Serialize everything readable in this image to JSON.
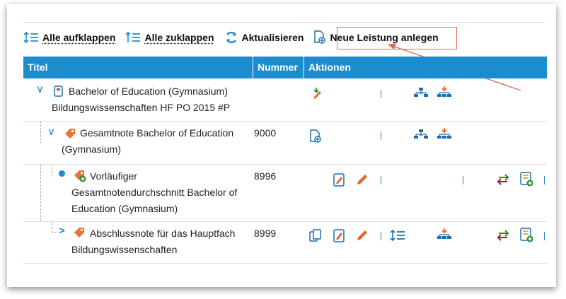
{
  "toolbar": {
    "expand_all": "Alle aufklappen",
    "collapse_all": "Alle zuklappen",
    "refresh": "Aktualisieren",
    "new_achievement": "Neue Leistung anlegen"
  },
  "table": {
    "columns": [
      "Titel",
      "Nummer",
      "Aktionen"
    ],
    "rows": [
      {
        "title_line1": "Bachelor of Education (Gymnasium)",
        "title_line2": "Bildungswissenschaften HF PO 2015 #P",
        "number": ""
      },
      {
        "title_line1": "Gesamtnote Bachelor of Education",
        "title_line2": "(Gymnasium)",
        "number": "9000"
      },
      {
        "title_line1": "Vorläufiger",
        "title_line2": "Gesamtnotendurchschnitt Bachelor of",
        "title_line3": "Education (Gymnasium)",
        "number": "8996"
      },
      {
        "title_line1": "Abschlussnote für das Hauptfach",
        "title_line2": "Bildungswissenschaften",
        "number": "8999"
      }
    ]
  },
  "colors": {
    "accent": "#1b8ccd",
    "highlight": "#e06a5a",
    "edit": "#e8602a",
    "move": "#2e8b2e",
    "swap_red": "#9b1c2c"
  }
}
